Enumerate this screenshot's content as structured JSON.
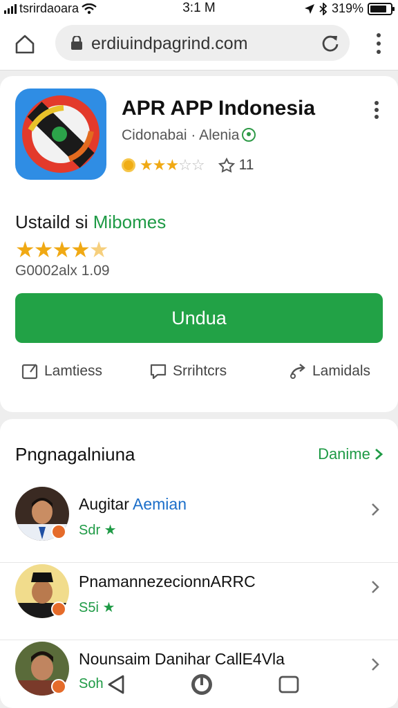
{
  "status_bar": {
    "carrier": "tsrirdaoara",
    "time": "3:1 M",
    "battery_text": "319%",
    "battery_level": 0.82
  },
  "browser": {
    "url": "erdiuindpagrind.com"
  },
  "app": {
    "title": "APR APP Indonesia",
    "developer": "Cidonabai · Alenia",
    "rating_stars": 3.5,
    "stars_small": "★★★",
    "stars_small_empty": "☆☆",
    "reviews_count": "11",
    "section_title_prefix": "Ustaild si",
    "section_title_accent": "Mibomes",
    "stars_big": "★★★★",
    "stars_big_half": "★",
    "rating_label": "G0002alx 1.09",
    "install_label": "Undua",
    "actions": [
      {
        "label": "Lamtiess",
        "icon": "bookmark-icon"
      },
      {
        "label": "Srrihtcrs",
        "icon": "comment-icon"
      },
      {
        "label": "Lamidals",
        "icon": "share-icon"
      }
    ],
    "accent_color": "#22a246"
  },
  "people": {
    "title": "Pngnagalniuna",
    "more_label": "Danime",
    "items": [
      {
        "name": "Augitar",
        "name_accent": "Aemian",
        "sub": "Sdr ★"
      },
      {
        "name": "PnamannezecionnARRC",
        "name_accent": "",
        "sub": "S5i ★"
      },
      {
        "name": "Nounsaim Danihar CallE4Vla",
        "name_accent": "",
        "sub": "Soh"
      }
    ]
  }
}
